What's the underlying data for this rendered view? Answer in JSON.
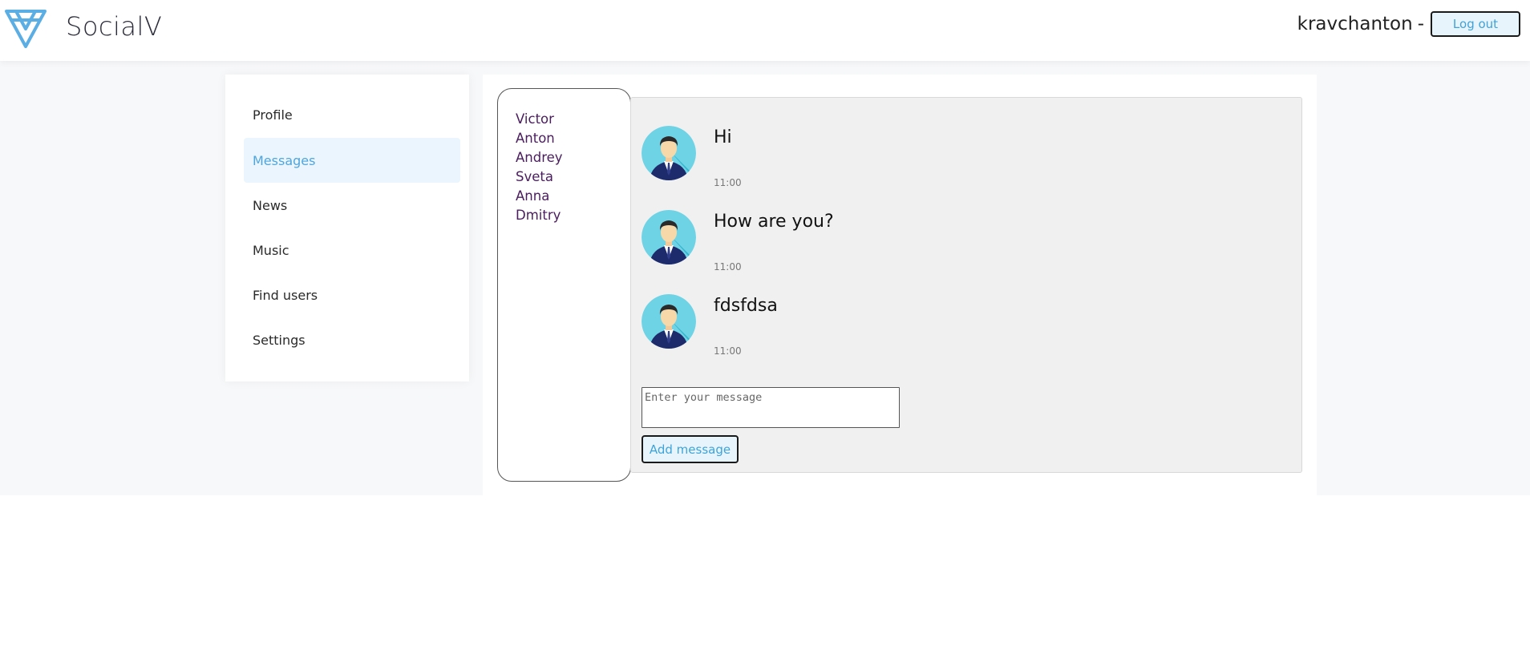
{
  "header": {
    "logo_icon": "triangle-logo-icon",
    "logo_text": "SocialV",
    "username": "kravchanton",
    "separator": "-",
    "logout_label": "Log out"
  },
  "colors": {
    "accent": "#50a6dc",
    "active_nav_bg": "#eaf5fd",
    "dialog_link": "#4a1d5e",
    "messages_bg": "#f0f0f0",
    "page_bg": "#f7f8fa"
  },
  "sidebar": {
    "items": [
      {
        "label": "Profile",
        "active": false
      },
      {
        "label": "Messages",
        "active": true
      },
      {
        "label": "News",
        "active": false
      },
      {
        "label": "Music",
        "active": false
      },
      {
        "label": "Find users",
        "active": false
      },
      {
        "label": "Settings",
        "active": false
      }
    ]
  },
  "dialogs": {
    "items": [
      "Victor",
      "Anton",
      "Andrey",
      "Sveta",
      "Anna",
      "Dmitry"
    ]
  },
  "messages": {
    "items": [
      {
        "text": "Hi",
        "time": "11:00",
        "avatar": "user-avatar-icon"
      },
      {
        "text": "How are you?",
        "time": "11:00",
        "avatar": "user-avatar-icon"
      },
      {
        "text": "fdsfdsa",
        "time": "11:00",
        "avatar": "user-avatar-icon"
      }
    ],
    "input_value": "",
    "input_placeholder": "Enter your message",
    "add_label": "Add message"
  }
}
